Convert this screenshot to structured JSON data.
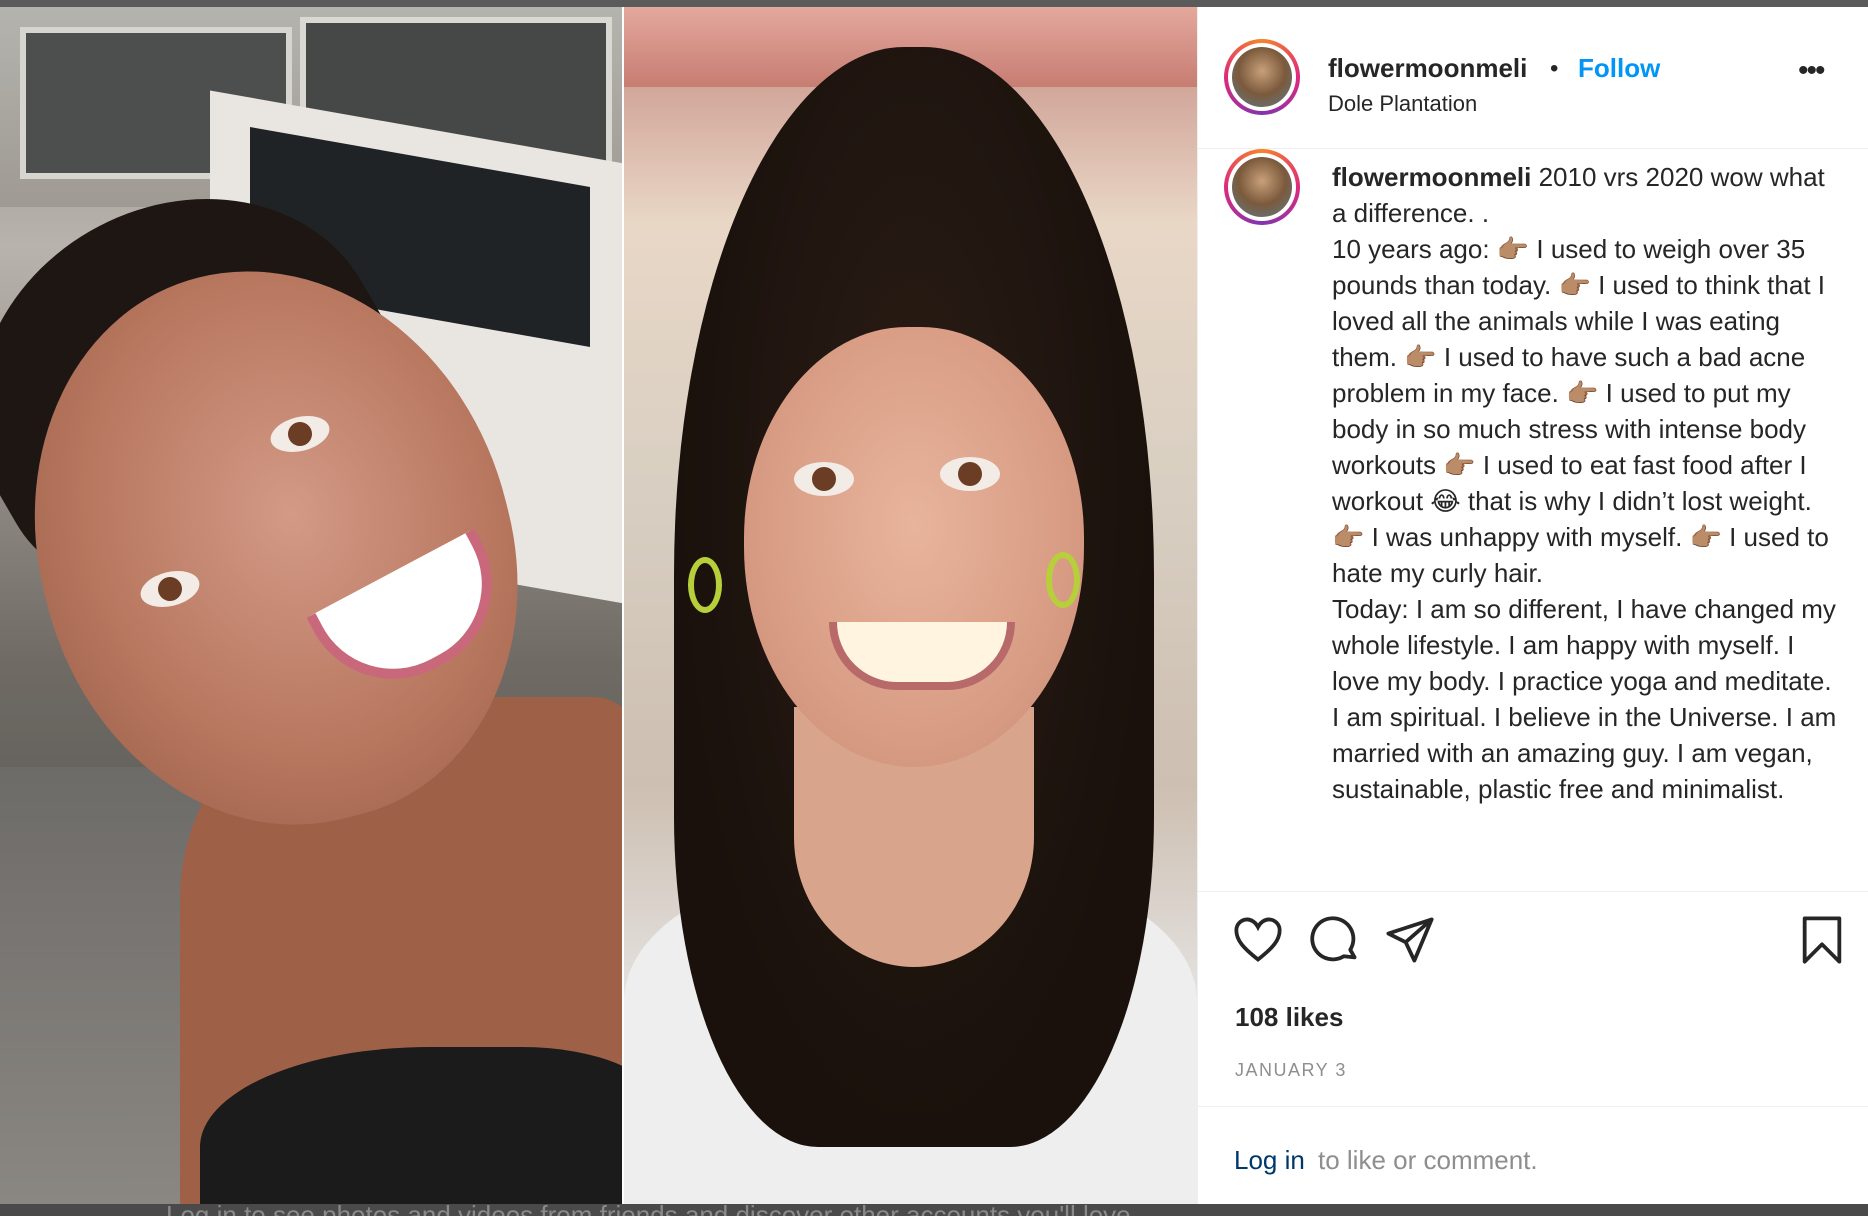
{
  "post": {
    "username": "flowermoonmeli",
    "dot": "•",
    "follow_label": "Follow",
    "location": "Dole Plantation",
    "more_label": "•••"
  },
  "caption": {
    "username": "flowermoonmeli",
    "lines": [
      " 2010 vrs 2020 wow what a difference. .",
      "10 years ago: 👉🏽 I used to weigh over 35 pounds than today. 👉🏽 I used to think that I loved all the animals while I was eating them. 👉🏽 I used to have such a bad acne problem in my face. 👉🏽 I used to put my body in so much stress with intense body workouts 👉🏽 I used to eat fast food after I workout 😂 that is why I didn’t lost weight. 👉🏽 I was unhappy with myself. 👉🏽 I used to hate my curly hair.",
      "Today: I am so different, I have changed my whole lifestyle. I am happy with myself. I love my body. I practice yoga and meditate. I am spiritual. I believe in the Universe. I am married with an amazing guy. I am vegan, sustainable, plastic free and minimalist."
    ]
  },
  "actions": {
    "like_icon": "heart-icon",
    "comment_icon": "comment-icon",
    "share_icon": "share-icon",
    "save_icon": "bookmark-icon"
  },
  "likes": "108 likes",
  "date": "JANUARY 3",
  "login": {
    "link": "Log in",
    "rest": " to like or comment."
  },
  "footer_text": "Log in to see photos and videos from friends and discover other accounts you'll love.",
  "colors": {
    "link_blue": "#0095f6",
    "text": "#262626",
    "muted": "#8e8e8e"
  }
}
